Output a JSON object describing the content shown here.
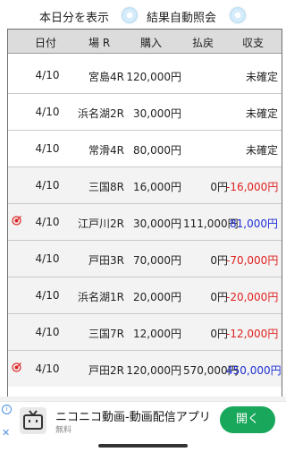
{
  "top": {
    "show_today_label": "本日分を表示",
    "auto_check_label": "結果自動照会"
  },
  "table": {
    "headers": [
      "日付",
      "場 R",
      "購入",
      "払戻",
      "収支"
    ],
    "rows": [
      {
        "date": "4/10",
        "venue": "宮島4R",
        "buy": "120,000円",
        "pay": "",
        "balance": "未確定",
        "status": "neutral",
        "hit": false
      },
      {
        "date": "4/10",
        "venue": "浜名湖2R",
        "buy": "30,000円",
        "pay": "",
        "balance": "未確定",
        "status": "neutral",
        "hit": false
      },
      {
        "date": "4/10",
        "venue": "常滑4R",
        "buy": "80,000円",
        "pay": "",
        "balance": "未確定",
        "status": "neutral",
        "hit": false
      },
      {
        "date": "4/10",
        "venue": "三国8R",
        "buy": "16,000円",
        "pay": "0円",
        "balance": "-16,000円",
        "status": "negative",
        "hit": false
      },
      {
        "date": "4/10",
        "venue": "江戸川2R",
        "buy": "30,000円",
        "pay": "111,000円",
        "balance": "81,000円",
        "status": "positive",
        "hit": true
      },
      {
        "date": "4/10",
        "venue": "戸田3R",
        "buy": "70,000円",
        "pay": "0円",
        "balance": "-70,000円",
        "status": "negative",
        "hit": false
      },
      {
        "date": "4/10",
        "venue": "浜名湖1R",
        "buy": "20,000円",
        "pay": "0円",
        "balance": "-20,000円",
        "status": "negative",
        "hit": false
      },
      {
        "date": "4/10",
        "venue": "三国7R",
        "buy": "12,000円",
        "pay": "0円",
        "balance": "-12,000円",
        "status": "negative",
        "hit": false
      },
      {
        "date": "4/10",
        "venue": "戸田2R",
        "buy": "120,000円",
        "pay": "570,000円",
        "balance": "450,000円",
        "status": "positive",
        "hit": true
      }
    ]
  },
  "ad": {
    "title": "ニコニコ動画-動画配信アプリ",
    "subtitle": "無料",
    "button_label": "開く"
  },
  "colors": {
    "negative": "#e02020",
    "positive": "#1f2fd6",
    "header_bg": "#dcdcdc",
    "ad_button": "#19a85b"
  }
}
